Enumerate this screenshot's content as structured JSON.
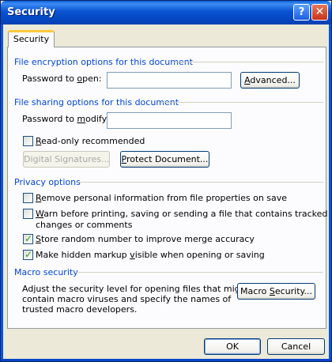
{
  "window": {
    "title": "Security",
    "help": "?",
    "close": "✕"
  },
  "tab": {
    "label": "Security"
  },
  "encryption": {
    "heading": "File encryption options for this document",
    "password_label_pre": "Password to ",
    "password_label_key": "o",
    "password_label_post": "pen:",
    "password_value": "",
    "advanced_pre": "",
    "advanced_key": "A",
    "advanced_post": "dvanced..."
  },
  "sharing": {
    "heading": "File sharing options for this document",
    "modify_label_pre": "Password to ",
    "modify_label_key": "m",
    "modify_label_post": "odify:",
    "modify_value": "",
    "readonly_pre": "",
    "readonly_key": "R",
    "readonly_post": "ead-only recommended",
    "readonly_checked": false,
    "digital_signatures": "Digital Signatures...",
    "protect_pre": "",
    "protect_key": "P",
    "protect_post": "rotect Document..."
  },
  "privacy": {
    "heading": "Privacy options",
    "items": [
      {
        "pre": "",
        "key": "R",
        "post": "emove personal information from file properties on save",
        "checked": false
      },
      {
        "pre": "",
        "key": "W",
        "post": "arn before printing, saving or sending a file that contains tracked",
        "line2": "changes or comments",
        "checked": false
      },
      {
        "pre": "",
        "key": "S",
        "post": "tore random number to improve merge accuracy",
        "checked": true
      },
      {
        "pre": "Make hidden markup ",
        "key": "v",
        "post": "isible when opening or saving",
        "checked": true
      }
    ]
  },
  "macro": {
    "heading": "Macro security",
    "desc_line1": "Adjust the security level for opening files that might",
    "desc_line2": "contain macro viruses and specify the names of",
    "desc_line3": "trusted macro developers.",
    "btn_pre": "Macro ",
    "btn_key": "S",
    "btn_post": "ecurity..."
  },
  "footer": {
    "ok": "OK",
    "cancel": "Cancel"
  },
  "colors": {
    "title_bar": "#0853d2",
    "section_heading": "#0046d5",
    "tab_accent": "#ffc73c",
    "checkmark": "#21a121"
  }
}
